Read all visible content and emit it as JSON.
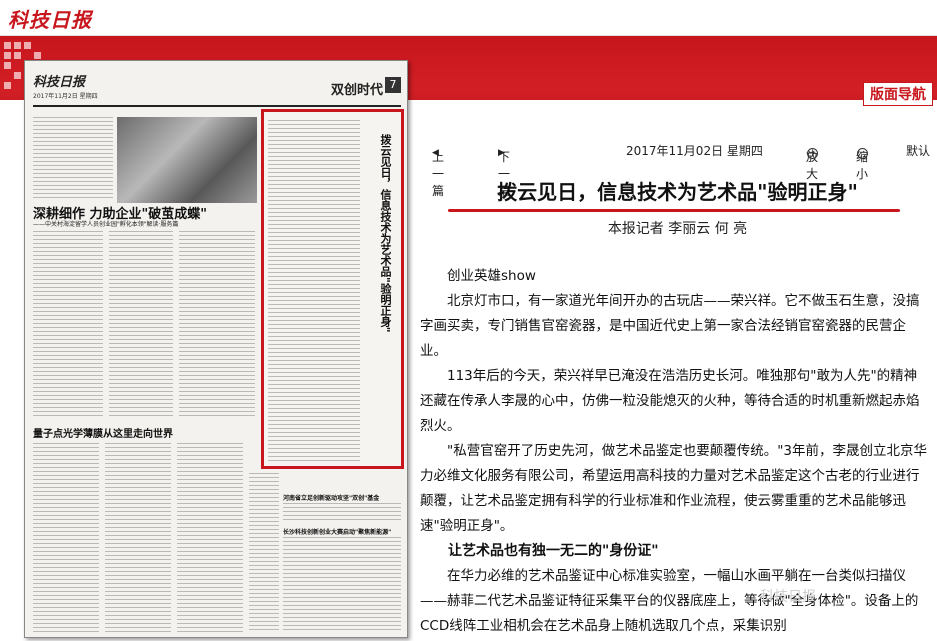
{
  "site": {
    "logo": "科技日报"
  },
  "banner": {
    "nav_button": "版面导航"
  },
  "paper": {
    "mini_logo": "科技日报",
    "date": "2017年11月2日 星期四",
    "section": "双创时代",
    "page_no": "7",
    "headline_main": "深耕细作  力助企业\"破茧成蝶\"",
    "headline_main_sub": "——中关村海淀留学人员创业园\"孵化本领\"解读·服务篇",
    "headline_bottom": "量子点光学薄膜从这里走向世界",
    "headline_right1": "河南省立足创新驱动攻坚\"双创\"基金",
    "headline_right2": "长沙科技创新创业大赛启动\"聚焦新能源\"",
    "highlight_title": "拨云见日，信息技术为艺术品\"验明正身\""
  },
  "toolbar": {
    "prev": "上一篇",
    "next": "下一篇",
    "date": "2017年11月02日 星期四",
    "zoom_in": "放大",
    "zoom_out": "缩小",
    "default": "默认"
  },
  "article": {
    "title": "拨云见日，信息技术为艺术品\"验明正身\"",
    "byline": "本报记者 李丽云 何 亮",
    "column": "创业英雄show",
    "p1": "北京灯市口，有一家道光年间开办的古玩店——荣兴祥。它不做玉石生意，没搞字画买卖，专门销售官窑瓷器，是中国近代史上第一家合法经销官窑瓷器的民营企业。",
    "p2": "113年后的今天，荣兴祥早已淹没在浩浩历史长河。唯独那句\"敢为人先\"的精神还藏在传承人李晟的心中，仿佛一粒没能熄灭的火种，等待合适的时机重新燃起赤焰烈火。",
    "p3": "\"私营官窑开了历史先河，做艺术品鉴定也要颠覆传统。\"3年前，李晟创立北京华力必维文化服务有限公司，希望运用高科技的力量对艺术品鉴定这个古老的行业进行颠覆，让艺术品鉴定拥有科学的行业标准和作业流程，使云雾重重的艺术品能够迅速\"验明正身\"。",
    "subhead": "让艺术品也有独一无二的\"身份证\"",
    "p4": "在华力必维的艺术品鉴证中心标准实验室，一幅山水画平躺在一台类似扫描仪——赫菲二代艺术品鉴证特征采集平台的仪器底座上，等待做\"全身体检\"。设备上的CCD线阵工业相机会在艺术品身上随机选取几个点，采集识别"
  },
  "watermark": "科技日报"
}
